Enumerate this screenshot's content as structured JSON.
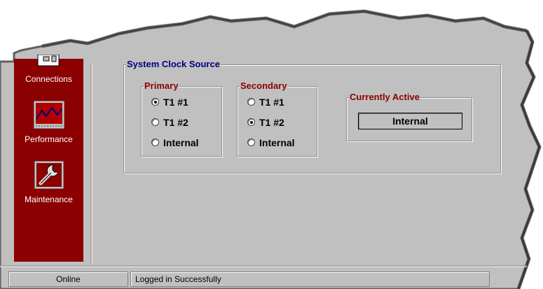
{
  "sidebar": {
    "items": [
      {
        "label": "Connections",
        "icon": "connections-icon"
      },
      {
        "label": "Performance",
        "icon": "performance-chart-icon"
      },
      {
        "label": "Maintenance",
        "icon": "wrench-icon"
      }
    ]
  },
  "clock_group": {
    "title": "System Clock Source",
    "primary": {
      "title": "Primary",
      "options": [
        "T1 #1",
        "T1 #2",
        "Internal"
      ],
      "selected": "T1 #1"
    },
    "secondary": {
      "title": "Secondary",
      "options": [
        "T1 #1",
        "T1 #2",
        "Internal"
      ],
      "selected": "T1 #2"
    },
    "active": {
      "title": "Currently Active",
      "value": "Internal"
    }
  },
  "statusbar": {
    "connection": "Online",
    "message": "Logged in Successfully"
  },
  "colors": {
    "sidebar_bg": "#8b0000",
    "panel_bg": "#c0c0c0",
    "group_title": "#000080",
    "subgroup_title": "#8b0000"
  }
}
